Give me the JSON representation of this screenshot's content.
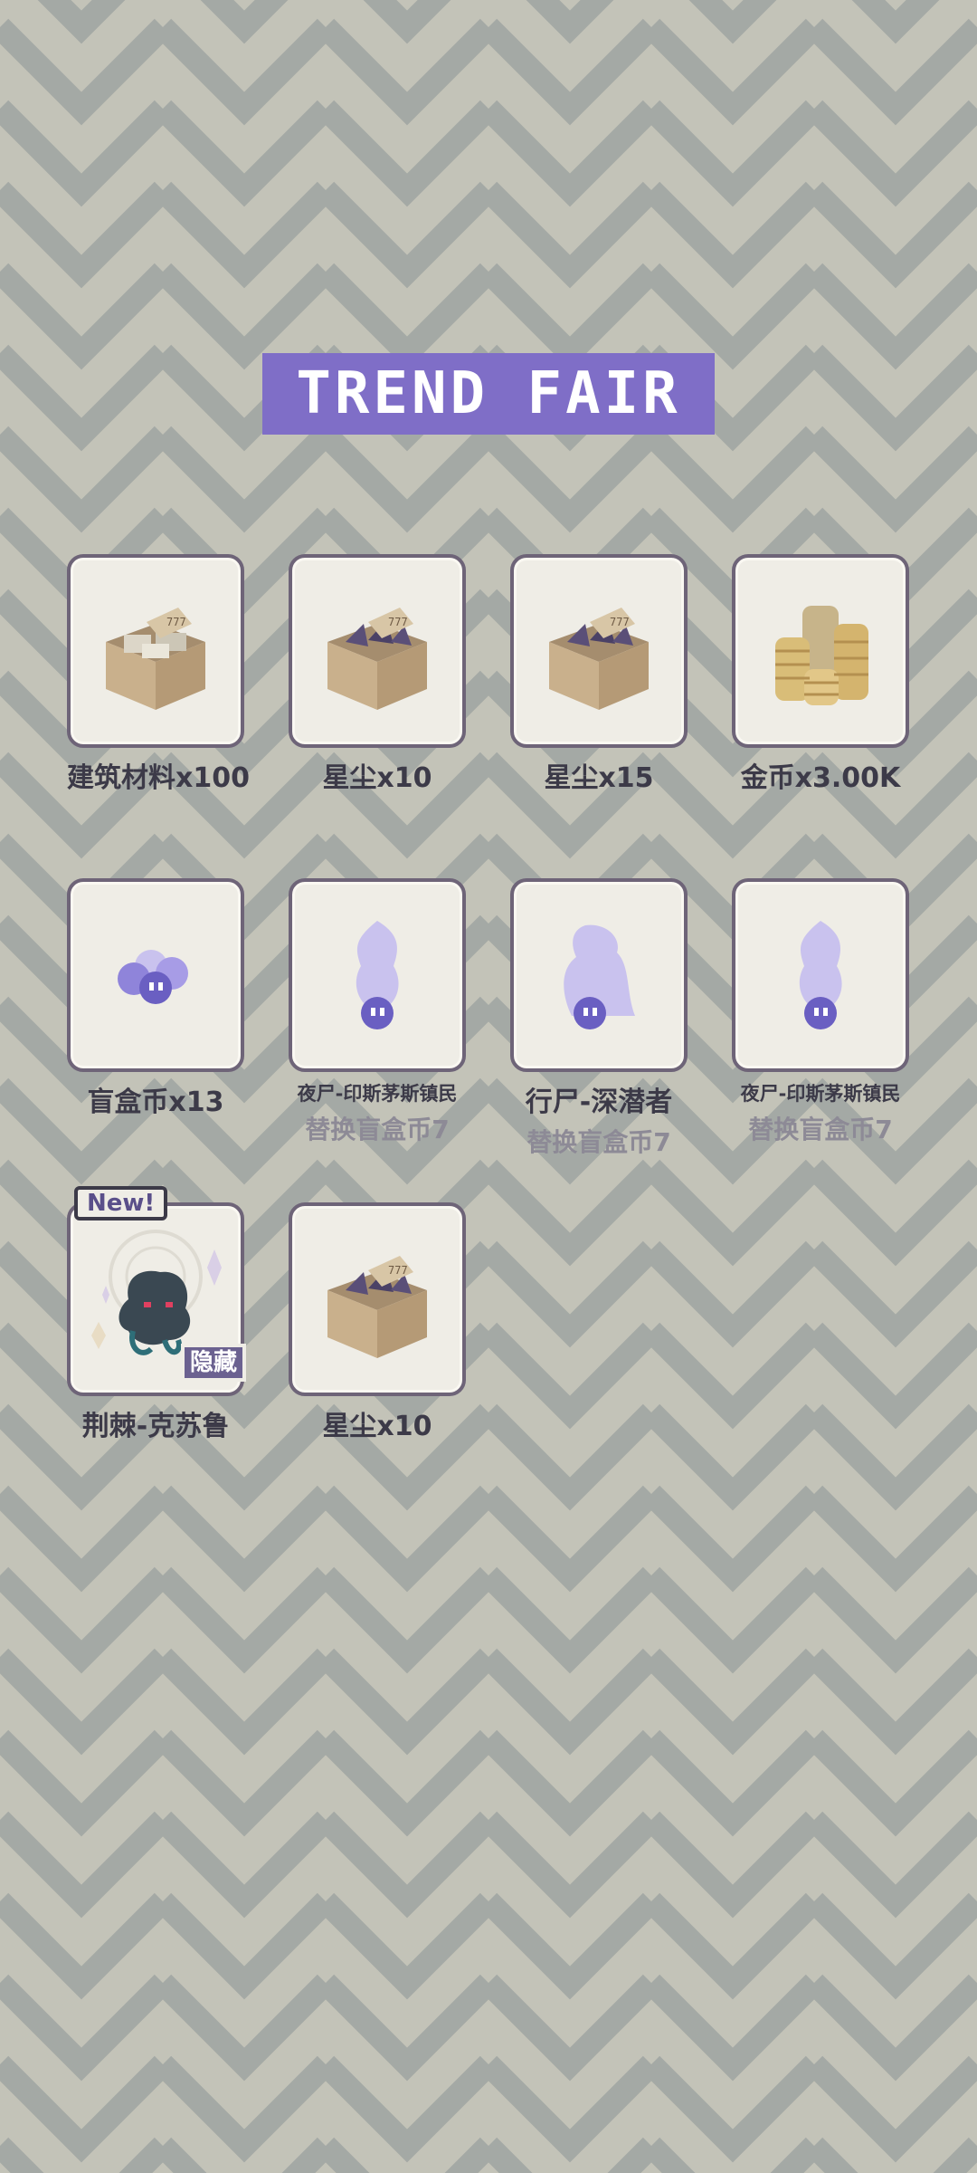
{
  "title": "TREND FAIR",
  "items": [
    {
      "label": "建筑材料x100",
      "icon": "crate-materials-icon"
    },
    {
      "label": "星尘x10",
      "icon": "crate-stardust-icon"
    },
    {
      "label": "星尘x15",
      "icon": "crate-stardust-icon"
    },
    {
      "label": "金币x3.00K",
      "icon": "gold-coins-icon"
    },
    {
      "label": "盲盒币x13",
      "icon": "blind-box-coins-icon"
    },
    {
      "label": "夜尸-印斯茅斯镇民",
      "sub": "替换盲盒币7",
      "icon": "ghost-silhouette-icon"
    },
    {
      "label": "行尸-深潜者",
      "sub": "替换盲盒币7",
      "icon": "ghost-silhouette-icon"
    },
    {
      "label": "夜尸-印斯茅斯镇民",
      "sub": "替换盲盒币7",
      "icon": "ghost-silhouette-icon"
    },
    {
      "label": "荆棘-克苏鲁",
      "icon": "cthulhu-icon",
      "new_badge": "New!",
      "hidden_badge": "隐藏"
    },
    {
      "label": "星尘x10",
      "icon": "crate-stardust-icon"
    }
  ],
  "colors": {
    "accent": "#7f6ec7",
    "card": "#efede6",
    "border": "#6e6478"
  }
}
